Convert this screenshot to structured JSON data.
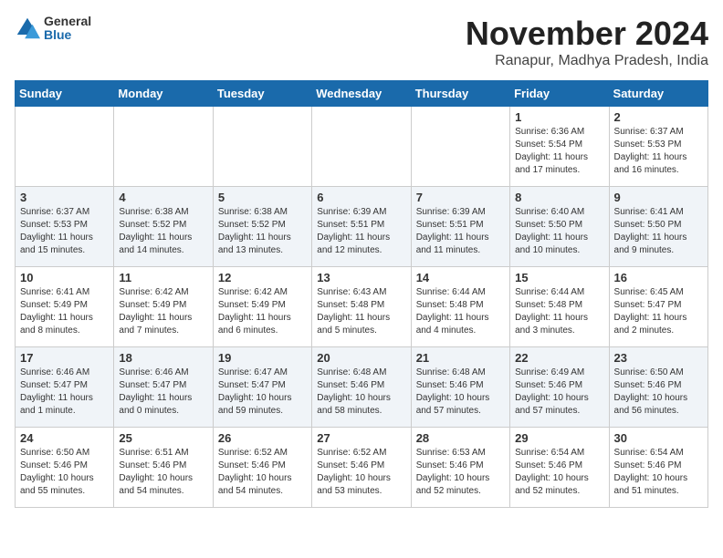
{
  "logo": {
    "text_general": "General",
    "text_blue": "Blue"
  },
  "title": "November 2024",
  "location": "Ranapur, Madhya Pradesh, India",
  "weekdays": [
    "Sunday",
    "Monday",
    "Tuesday",
    "Wednesday",
    "Thursday",
    "Friday",
    "Saturday"
  ],
  "weeks": [
    [
      {
        "day": "",
        "info": ""
      },
      {
        "day": "",
        "info": ""
      },
      {
        "day": "",
        "info": ""
      },
      {
        "day": "",
        "info": ""
      },
      {
        "day": "",
        "info": ""
      },
      {
        "day": "1",
        "info": "Sunrise: 6:36 AM\nSunset: 5:54 PM\nDaylight: 11 hours and 17 minutes."
      },
      {
        "day": "2",
        "info": "Sunrise: 6:37 AM\nSunset: 5:53 PM\nDaylight: 11 hours and 16 minutes."
      }
    ],
    [
      {
        "day": "3",
        "info": "Sunrise: 6:37 AM\nSunset: 5:53 PM\nDaylight: 11 hours and 15 minutes."
      },
      {
        "day": "4",
        "info": "Sunrise: 6:38 AM\nSunset: 5:52 PM\nDaylight: 11 hours and 14 minutes."
      },
      {
        "day": "5",
        "info": "Sunrise: 6:38 AM\nSunset: 5:52 PM\nDaylight: 11 hours and 13 minutes."
      },
      {
        "day": "6",
        "info": "Sunrise: 6:39 AM\nSunset: 5:51 PM\nDaylight: 11 hours and 12 minutes."
      },
      {
        "day": "7",
        "info": "Sunrise: 6:39 AM\nSunset: 5:51 PM\nDaylight: 11 hours and 11 minutes."
      },
      {
        "day": "8",
        "info": "Sunrise: 6:40 AM\nSunset: 5:50 PM\nDaylight: 11 hours and 10 minutes."
      },
      {
        "day": "9",
        "info": "Sunrise: 6:41 AM\nSunset: 5:50 PM\nDaylight: 11 hours and 9 minutes."
      }
    ],
    [
      {
        "day": "10",
        "info": "Sunrise: 6:41 AM\nSunset: 5:49 PM\nDaylight: 11 hours and 8 minutes."
      },
      {
        "day": "11",
        "info": "Sunrise: 6:42 AM\nSunset: 5:49 PM\nDaylight: 11 hours and 7 minutes."
      },
      {
        "day": "12",
        "info": "Sunrise: 6:42 AM\nSunset: 5:49 PM\nDaylight: 11 hours and 6 minutes."
      },
      {
        "day": "13",
        "info": "Sunrise: 6:43 AM\nSunset: 5:48 PM\nDaylight: 11 hours and 5 minutes."
      },
      {
        "day": "14",
        "info": "Sunrise: 6:44 AM\nSunset: 5:48 PM\nDaylight: 11 hours and 4 minutes."
      },
      {
        "day": "15",
        "info": "Sunrise: 6:44 AM\nSunset: 5:48 PM\nDaylight: 11 hours and 3 minutes."
      },
      {
        "day": "16",
        "info": "Sunrise: 6:45 AM\nSunset: 5:47 PM\nDaylight: 11 hours and 2 minutes."
      }
    ],
    [
      {
        "day": "17",
        "info": "Sunrise: 6:46 AM\nSunset: 5:47 PM\nDaylight: 11 hours and 1 minute."
      },
      {
        "day": "18",
        "info": "Sunrise: 6:46 AM\nSunset: 5:47 PM\nDaylight: 11 hours and 0 minutes."
      },
      {
        "day": "19",
        "info": "Sunrise: 6:47 AM\nSunset: 5:47 PM\nDaylight: 10 hours and 59 minutes."
      },
      {
        "day": "20",
        "info": "Sunrise: 6:48 AM\nSunset: 5:46 PM\nDaylight: 10 hours and 58 minutes."
      },
      {
        "day": "21",
        "info": "Sunrise: 6:48 AM\nSunset: 5:46 PM\nDaylight: 10 hours and 57 minutes."
      },
      {
        "day": "22",
        "info": "Sunrise: 6:49 AM\nSunset: 5:46 PM\nDaylight: 10 hours and 57 minutes."
      },
      {
        "day": "23",
        "info": "Sunrise: 6:50 AM\nSunset: 5:46 PM\nDaylight: 10 hours and 56 minutes."
      }
    ],
    [
      {
        "day": "24",
        "info": "Sunrise: 6:50 AM\nSunset: 5:46 PM\nDaylight: 10 hours and 55 minutes."
      },
      {
        "day": "25",
        "info": "Sunrise: 6:51 AM\nSunset: 5:46 PM\nDaylight: 10 hours and 54 minutes."
      },
      {
        "day": "26",
        "info": "Sunrise: 6:52 AM\nSunset: 5:46 PM\nDaylight: 10 hours and 54 minutes."
      },
      {
        "day": "27",
        "info": "Sunrise: 6:52 AM\nSunset: 5:46 PM\nDaylight: 10 hours and 53 minutes."
      },
      {
        "day": "28",
        "info": "Sunrise: 6:53 AM\nSunset: 5:46 PM\nDaylight: 10 hours and 52 minutes."
      },
      {
        "day": "29",
        "info": "Sunrise: 6:54 AM\nSunset: 5:46 PM\nDaylight: 10 hours and 52 minutes."
      },
      {
        "day": "30",
        "info": "Sunrise: 6:54 AM\nSunset: 5:46 PM\nDaylight: 10 hours and 51 minutes."
      }
    ]
  ]
}
